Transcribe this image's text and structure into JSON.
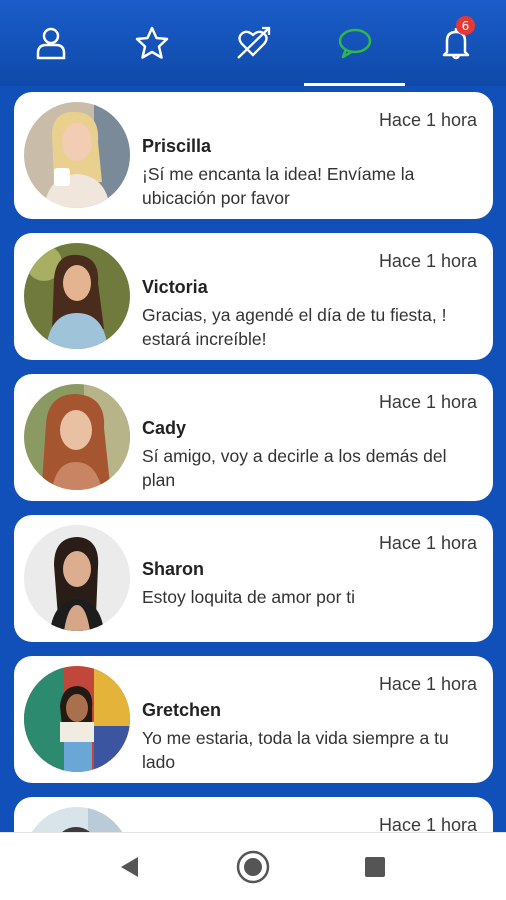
{
  "tabs": [
    {
      "icon": "profile-icon"
    },
    {
      "icon": "star-icon"
    },
    {
      "icon": "heart-arrow-icon"
    },
    {
      "icon": "chat-bubble-icon",
      "active": true
    },
    {
      "icon": "bell-icon",
      "badge": "6"
    }
  ],
  "colors": {
    "header": "#1a5cc9",
    "active_tab": "#2fb84a",
    "background": "#1150b8"
  },
  "conversations": [
    {
      "name": "Priscilla",
      "time": "Hace 1 hora",
      "message": "¡Sí me encanta la idea! Envíame la ubicación por favor"
    },
    {
      "name": "Victoria",
      "time": "Hace 1 hora",
      "message": "Gracias, ya agendé el día de tu fiesta, ! estará increíble!"
    },
    {
      "name": "Cady",
      "time": "Hace 1 hora",
      "message": "Sí amigo, voy a decirle a los demás del plan"
    },
    {
      "name": "Sharon",
      "time": "Hace 1 hora",
      "message": "Estoy loquita de amor por ti"
    },
    {
      "name": "Gretchen",
      "time": "Hace 1 hora",
      "message": "Yo me estaria, toda la vida siempre a tu lado"
    },
    {
      "name": "",
      "time": "Hace 1 hora",
      "message": ""
    }
  ],
  "navigation": [
    {
      "icon": "back-icon"
    },
    {
      "icon": "home-icon"
    },
    {
      "icon": "recents-icon"
    }
  ]
}
